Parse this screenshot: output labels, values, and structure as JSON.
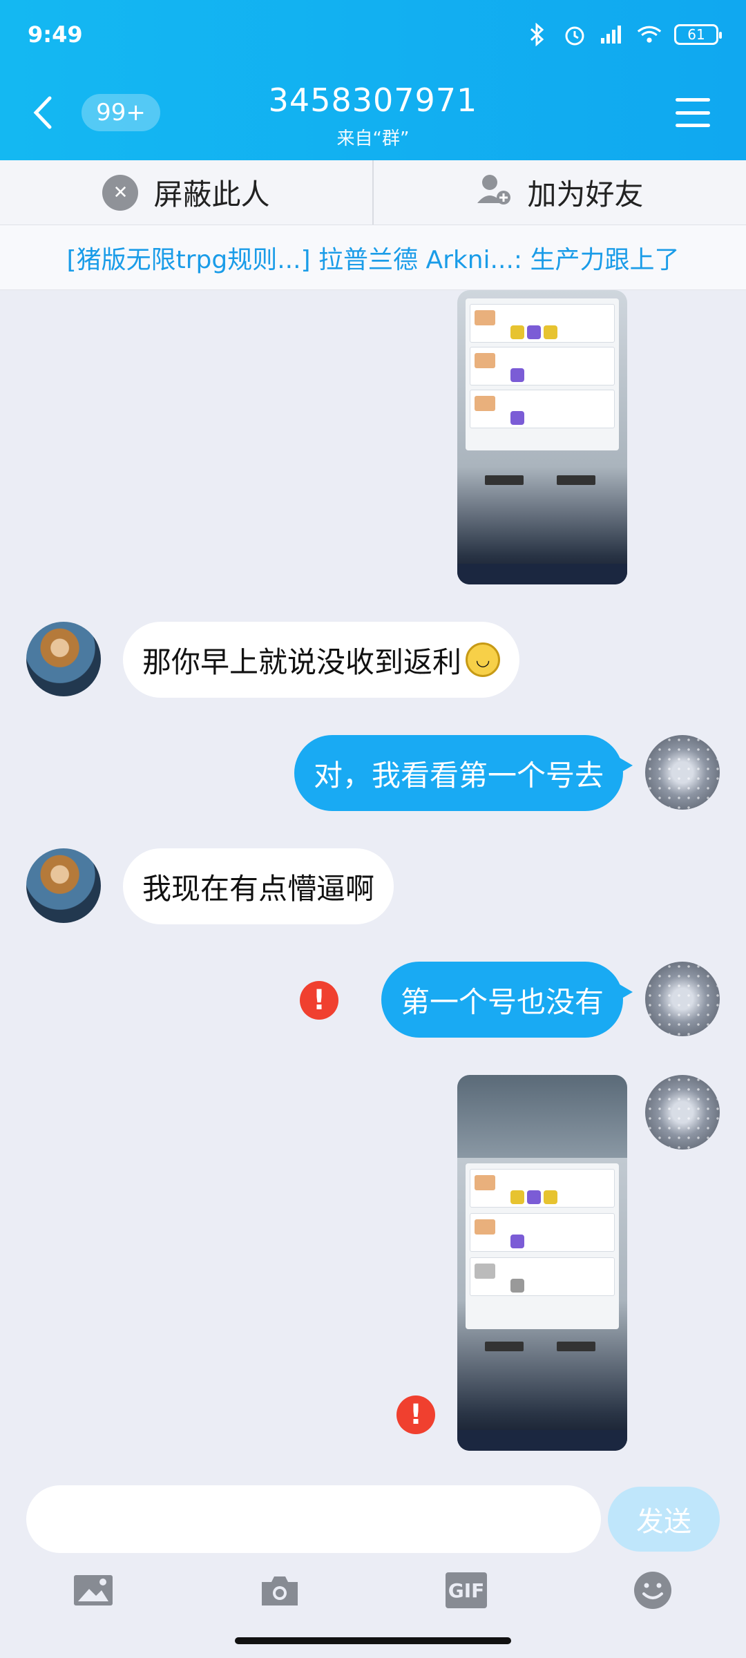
{
  "status": {
    "time": "9:49",
    "battery": "61"
  },
  "header": {
    "badge": "99+",
    "title": "3458307971",
    "subtitle": "来自“群”"
  },
  "actions": {
    "block_label": "屏蔽此人",
    "add_friend_label": "加为好友"
  },
  "notice": {
    "text": "[猪版无限trpg规则...] 拉普兰德 Arkni...: 生产力跟上了"
  },
  "messages": [
    {
      "side": "in",
      "text": "那你早上就说没收到返利"
    },
    {
      "side": "out",
      "text": "对，我看看第一个号去"
    },
    {
      "side": "in",
      "text": "我现在有点懵逼啊"
    },
    {
      "side": "out",
      "text": "第一个号也没有",
      "failed": true
    },
    {
      "side": "out",
      "type": "image",
      "failed": true
    }
  ],
  "input": {
    "send_label": "发送"
  },
  "toolbar": {
    "gif_label": "GIF"
  },
  "icons": [
    "back-icon",
    "menu-icon",
    "block-icon",
    "add-friend-icon",
    "error-icon",
    "image-icon",
    "camera-icon",
    "gif-icon",
    "emoji-icon"
  ],
  "colors": {
    "header": "#14b8f2",
    "outgoing_bubble": "#19aaf3",
    "send_disabled": "#bfe6fb",
    "error": "#f0402f"
  }
}
